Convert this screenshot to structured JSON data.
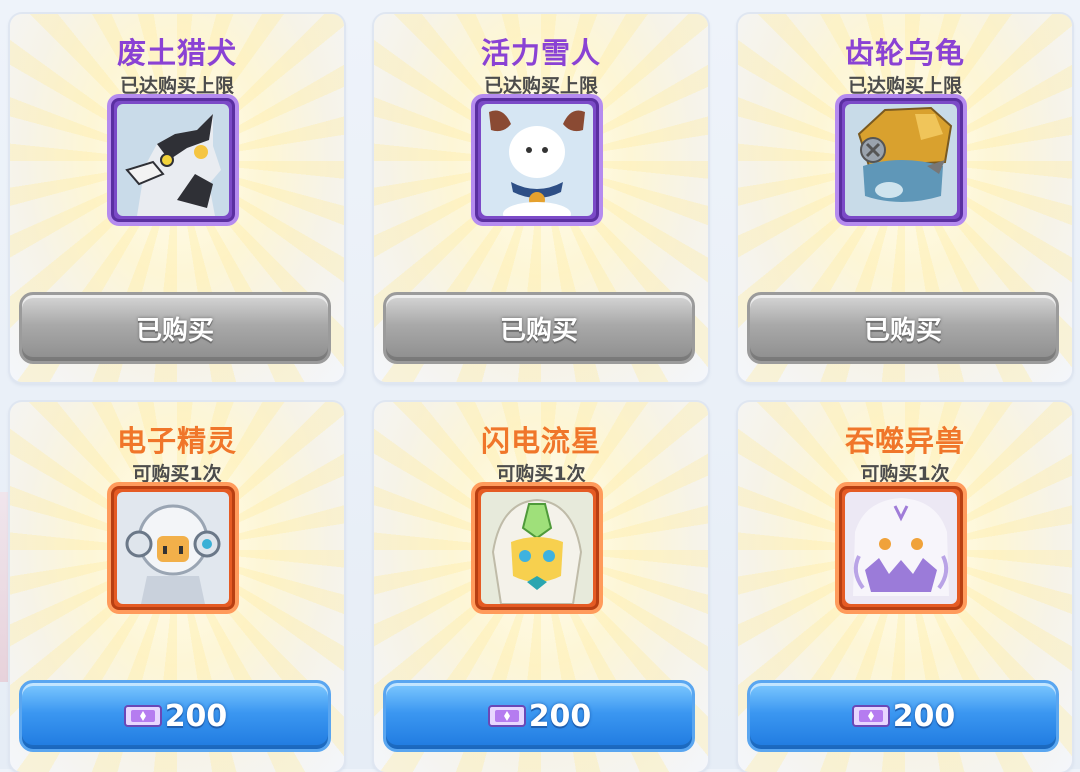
{
  "shop": {
    "items": [
      {
        "name": "废土猎犬",
        "status": "已达购买上限",
        "button": "已购买",
        "state": "purchased",
        "rarity": "purple",
        "portrait": "wolf-creature-portrait"
      },
      {
        "name": "活力雪人",
        "status": "已达购买上限",
        "button": "已购买",
        "state": "purchased",
        "rarity": "purple",
        "portrait": "snowman-creature-portrait"
      },
      {
        "name": "齿轮乌龟",
        "status": "已达购买上限",
        "button": "已购买",
        "state": "purchased",
        "rarity": "purple",
        "portrait": "gear-turtle-portrait"
      },
      {
        "name": "电子精灵",
        "status": "可购买1次",
        "price": "200",
        "currency_icon": "ticket-icon",
        "state": "available",
        "rarity": "orange",
        "portrait": "robot-sprite-portrait"
      },
      {
        "name": "闪电流星",
        "status": "可购买1次",
        "price": "200",
        "currency_icon": "ticket-icon",
        "state": "available",
        "rarity": "orange",
        "portrait": "lightning-creature-portrait"
      },
      {
        "name": "吞噬异兽",
        "status": "可购买1次",
        "price": "200",
        "currency_icon": "ticket-icon",
        "state": "available",
        "rarity": "orange",
        "portrait": "devourer-beast-portrait"
      }
    ]
  },
  "colors": {
    "purple_title": "#8a42d4",
    "orange_title": "#f0762a",
    "buy_button": "#3b97f1",
    "purchased_button": "#a9a9a9"
  }
}
